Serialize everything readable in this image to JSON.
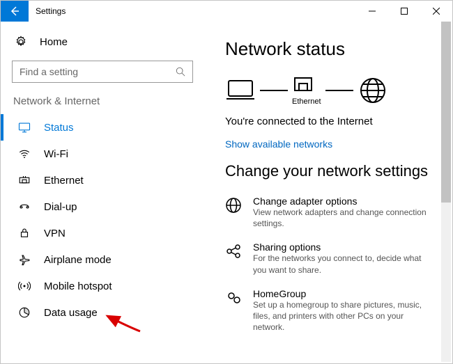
{
  "window": {
    "title": "Settings"
  },
  "sidebar": {
    "home_label": "Home",
    "search_placeholder": "Find a setting",
    "section_label": "Network & Internet",
    "items": [
      {
        "label": "Status",
        "icon": "status-icon",
        "active": true
      },
      {
        "label": "Wi-Fi",
        "icon": "wifi-icon",
        "active": false
      },
      {
        "label": "Ethernet",
        "icon": "ethernet-icon",
        "active": false
      },
      {
        "label": "Dial-up",
        "icon": "dialup-icon",
        "active": false
      },
      {
        "label": "VPN",
        "icon": "vpn-icon",
        "active": false
      },
      {
        "label": "Airplane mode",
        "icon": "airplane-icon",
        "active": false
      },
      {
        "label": "Mobile hotspot",
        "icon": "hotspot-icon",
        "active": false
      },
      {
        "label": "Data usage",
        "icon": "data-usage-icon",
        "active": false
      }
    ]
  },
  "content": {
    "heading_status": "Network status",
    "diagram_label": "Ethernet",
    "connected_text": "You're connected to the Internet",
    "show_networks_link": "Show available networks",
    "heading_change": "Change your network settings",
    "settings": [
      {
        "title": "Change adapter options",
        "desc": "View network adapters and change connection settings."
      },
      {
        "title": "Sharing options",
        "desc": "For the networks you connect to, decide what you want to share."
      },
      {
        "title": "HomeGroup",
        "desc": "Set up a homegroup to share pictures, music, files, and printers with other PCs on your network."
      }
    ]
  }
}
